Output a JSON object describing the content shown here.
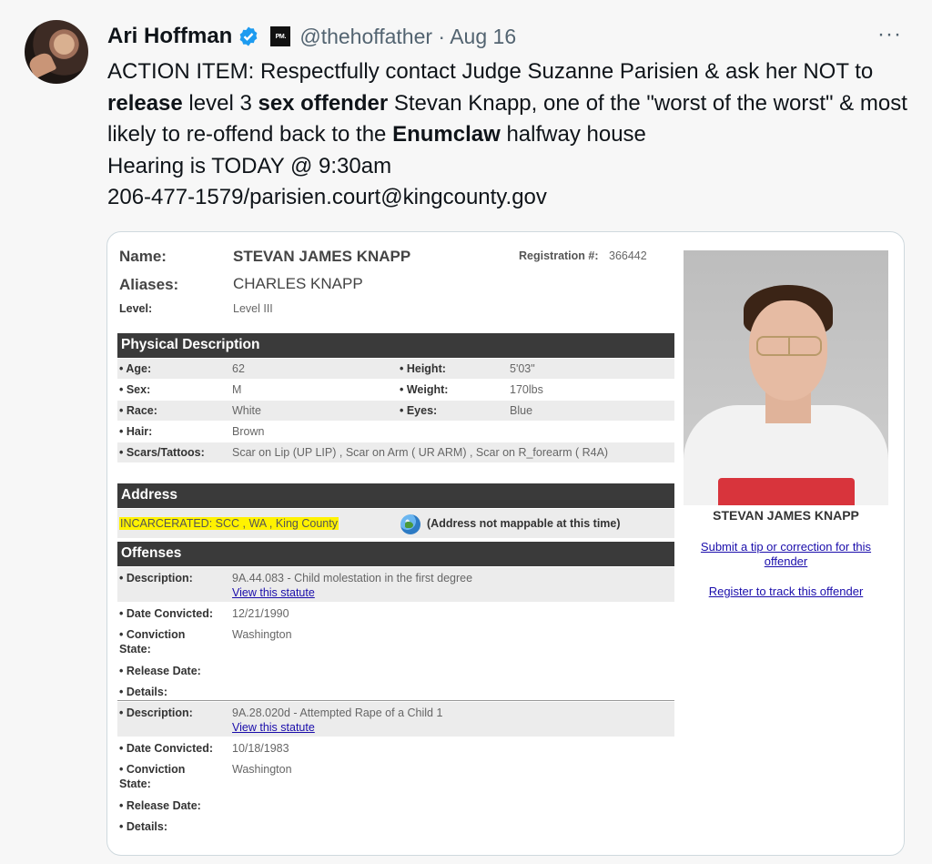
{
  "tweet": {
    "author_name": "Ari Hoffman",
    "badge_text": "PM.",
    "handle_date": "@thehoffather · Aug 16",
    "more": "···",
    "text_parts": {
      "p1": "ACTION ITEM: Respectfully contact Judge Suzanne Parisien & ask her NOT to ",
      "b1": "release",
      "p2": " level 3 ",
      "b2": "sex offender",
      "p3": " Stevan Knapp, one of the \"worst of the worst\" & most likely to re-offend back to the ",
      "b3": "Enumclaw",
      "p4": " halfway house",
      "line2": "Hearing is TODAY @ 9:30am",
      "line3": "206-477-1579/parisien.court@kingcounty.gov"
    }
  },
  "record": {
    "name_label": "Name:",
    "name_value": "STEVAN JAMES KNAPP",
    "registration_label": "Registration #:",
    "registration_value": "366442",
    "aliases_label": "Aliases:",
    "aliases_value": "CHARLES KNAPP",
    "level_label": "Level:",
    "level_value": "Level III",
    "physical_header": "Physical Description",
    "physical": {
      "age_label": "• Age:",
      "age": "62",
      "height_label": "• Height:",
      "height": "5'03\"",
      "sex_label": "• Sex:",
      "sex": "M",
      "weight_label": "• Weight:",
      "weight": "170lbs",
      "race_label": "• Race:",
      "race": "White",
      "eyes_label": "• Eyes:",
      "eyes": "Blue",
      "hair_label": "• Hair:",
      "hair": "Brown",
      "scars_label": "• Scars/Tattoos:",
      "scars": "Scar on Lip (UP LIP) , Scar on Arm ( UR ARM) , Scar on R_forearm ( R4A)"
    },
    "address_header": "Address",
    "address_value": "INCARCERATED: SCC , WA , King County",
    "address_note": "(Address not mappable at this time)",
    "offenses_header": "Offenses",
    "offenses": [
      {
        "description_label": "• Description:",
        "description": "9A.44.083 - Child molestation in the first degree",
        "statute_link": "View this statute",
        "date_label": "• Date Convicted:",
        "date": "12/21/1990",
        "state_label_1": "• Conviction",
        "state_label_2": "State:",
        "state": "Washington",
        "release_label": "• Release Date:",
        "details_label": "• Details:"
      },
      {
        "description_label": "• Description:",
        "description": "9A.28.020d - Attempted Rape of a Child 1",
        "statute_link": "View this statute",
        "date_label": "• Date Convicted:",
        "date": "10/18/1983",
        "state_label_1": "• Conviction",
        "state_label_2": "State:",
        "state": "Washington",
        "release_label": "• Release Date:",
        "details_label": "• Details:"
      }
    ],
    "photo_caption": "STEVAN JAMES KNAPP",
    "tip_link": "Submit a tip or correction for this offender",
    "track_link": "Register to track this offender"
  },
  "colors": {
    "verified": "#1d9bf0",
    "header_bar": "#3a3a3a",
    "highlight": "#fff200",
    "link": "#1a0dab"
  }
}
